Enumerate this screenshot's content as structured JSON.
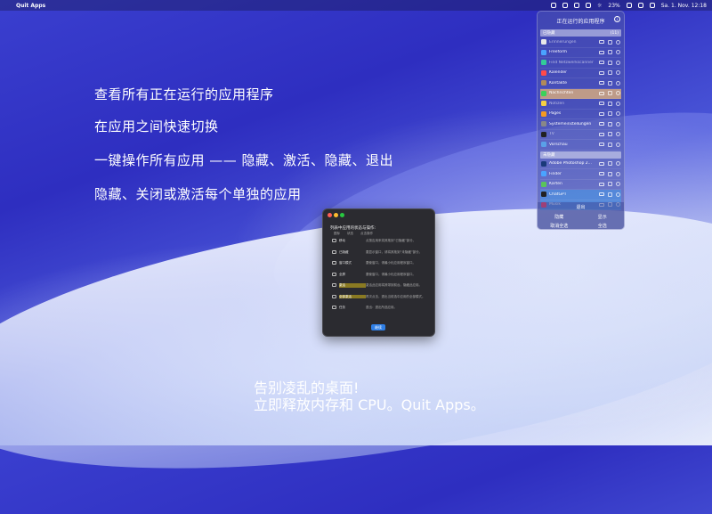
{
  "menubar": {
    "app_name": "Quit Apps",
    "battery": "23%",
    "date_time": "Sa. 1. Nov.  12:18"
  },
  "features": [
    "查看所有正在运行的应用程序",
    "在应用之间快速切换",
    "一键操作所有应用 —— 隐藏、激活、隐藏、退出",
    "隐藏、关闭或激活每个单独的应用"
  ],
  "tagline": {
    "line1": "告别凌乱的桌面!",
    "line2": "立即释放内存和 CPU。Quit Apps。"
  },
  "panel": {
    "title": "正在运行的应用程序",
    "section_hidden": "已隐藏",
    "section_hidden_count": "(11)",
    "hidden_apps": [
      {
        "name": "Erinnerungen",
        "color": "#e8e8e8",
        "dim": true
      },
      {
        "name": "Freeform",
        "color": "#4aa3ff",
        "dim": false
      },
      {
        "name": "Find Netzwerkscanner",
        "color": "#3c9",
        "dim": true
      },
      {
        "name": "Kalender",
        "color": "#ff4a4a",
        "dim": false
      },
      {
        "name": "Kontakte",
        "color": "#b08a5a",
        "dim": false
      },
      {
        "name": "Nachrichten",
        "color": "#3ad15a",
        "dim": false
      },
      {
        "name": "Notizen",
        "color": "#f5d142",
        "dim": true
      },
      {
        "name": "Pages",
        "color": "#f59a22",
        "dim": false
      },
      {
        "name": "Systemeinstellungen",
        "color": "#888",
        "dim": false
      },
      {
        "name": "TV",
        "color": "#222",
        "dim": true
      },
      {
        "name": "Vorschau",
        "color": "#5aa0e8",
        "dim": false
      }
    ],
    "section_visible": "未隐藏",
    "visible_apps": [
      {
        "name": "Adobe Photoshop 2...",
        "color": "#1a3a7a"
      },
      {
        "name": "Finder",
        "color": "#4aa3ff"
      },
      {
        "name": "Karten",
        "color": "#5ac45a"
      },
      {
        "name": "ChatGPT",
        "color": "#222"
      },
      {
        "name": "Musik",
        "color": "#ff3a5a"
      }
    ],
    "quit_label": "退出",
    "hide_label": "隐藏",
    "show_label": "显示",
    "deselect_label": "取消全选",
    "select_all_label": "全选"
  },
  "dialog": {
    "title": "列表中应用的状态与操作:",
    "col_icon": "图标",
    "col_state": "状态",
    "col_action": "点击操作",
    "rows": [
      {
        "label": "移动",
        "desc": "点按应用来将其拖到“已隐藏”部分。",
        "hl": false
      },
      {
        "label": "已隐藏",
        "desc": "要显示窗口，请将其拖到“未隐藏”部分。",
        "hl": false
      },
      {
        "label": "窗口模式",
        "desc": "要使窗口，请最小化应用程序窗口。",
        "hl": false
      },
      {
        "label": "全屏",
        "desc": "要使窗口，请最小化应用程序窗口。",
        "hl": false
      },
      {
        "label": "激活",
        "desc": "激活此应用将其带到前台。隐藏此应用。",
        "hl": true
      },
      {
        "label": "全部激活",
        "desc": "再次点击，退出当前选中应用的全部模式。",
        "hl": true
      },
      {
        "label": "任务",
        "desc": "退出：退出所选应用。",
        "hl": false
      }
    ],
    "ok_label": "继续"
  }
}
